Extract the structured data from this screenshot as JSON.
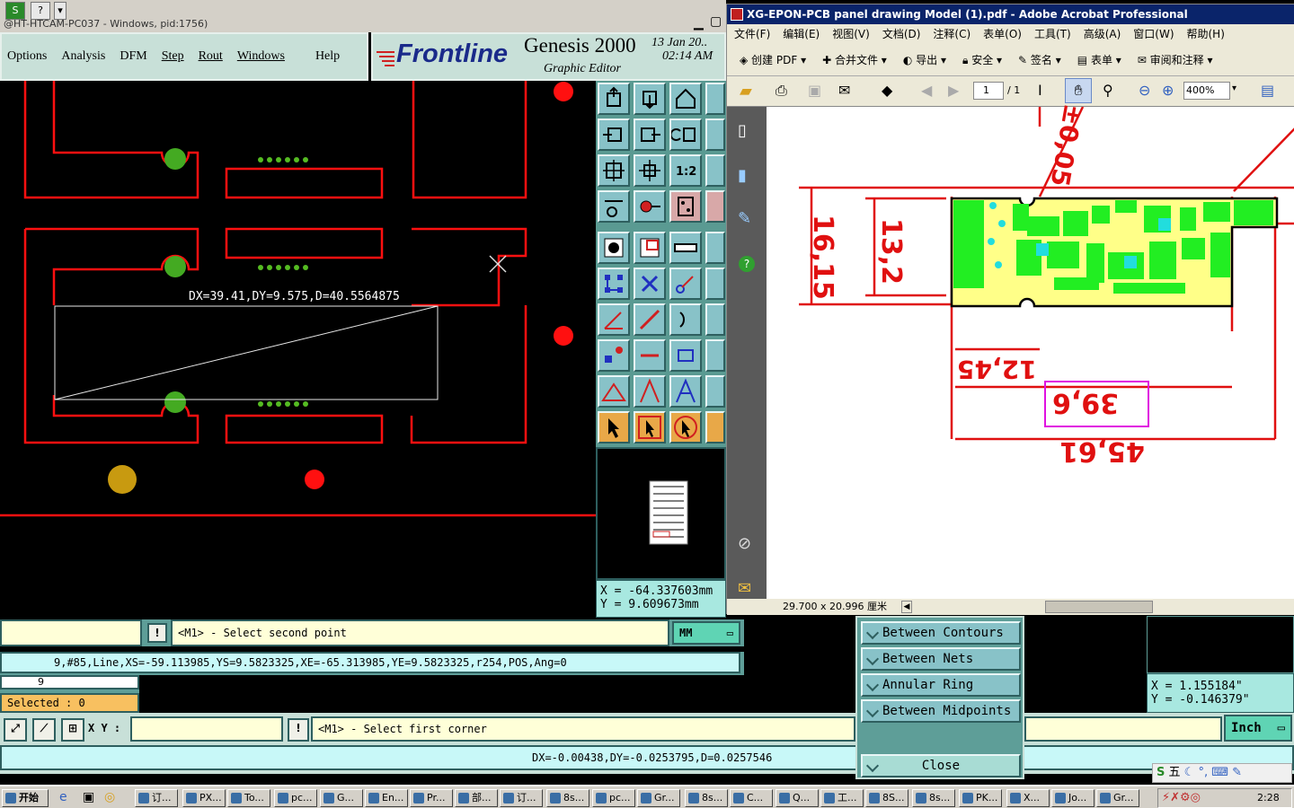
{
  "genesis": {
    "window_title": "@HT-HTCAM-PC037 - Windows, pid:1756)",
    "menu": [
      "Options",
      "Analysis",
      "DFM",
      "Step",
      "Rout",
      "Windows",
      "Help"
    ],
    "logo_text": "Frontline",
    "product": "Genesis 2000",
    "subtitle": "Graphic Editor",
    "date": "13 Jan 20..",
    "time": "02:14 AM",
    "measure_label": "DX=39.41,DY=9.575,D=40.5564875",
    "coords": {
      "x": "X = -64.337603mm",
      "y": "Y = 9.609673mm"
    },
    "prompt1": "<M1> - Select second point",
    "units1": "MM",
    "feature_info": "9,#85,Line,XS=-59.113985,YS=9.5823325,XE=-65.313985,YE=9.5823325,r254,POS,Ang=0",
    "layer_num": "9",
    "selected": "Selected : 0",
    "xy_label": "X Y :",
    "prompt2": "<M1> - Select first corner",
    "delta": "DX=-0.00438,DY=-0.0253795,D=0.0257546",
    "coords2": {
      "x": "X = 1.155184\"",
      "y": "Y = -0.146379\""
    },
    "units2": "Inch",
    "info_button": "!"
  },
  "dfm_menu": {
    "items": [
      "Between Contours",
      "Between Nets",
      "Annular Ring",
      "Between Midpoints"
    ],
    "close": "Close"
  },
  "acrobat": {
    "title": "XG-EPON-PCB panel drawing Model (1).pdf - Adobe Acrobat Professional",
    "menu": [
      "文件(F)",
      "编辑(E)",
      "视图(V)",
      "文档(D)",
      "注释(C)",
      "表单(O)",
      "工具(T)",
      "高级(A)",
      "窗口(W)",
      "帮助(H)"
    ],
    "toolbar": [
      "创建 PDF",
      "合并文件",
      "导出",
      "安全",
      "签名",
      "表单",
      "审阅和注释"
    ],
    "page_num": "1",
    "page_total": "/ 1",
    "zoom": "400%",
    "page_size": "29.700 x 20.996 厘米",
    "dims": {
      "d1": "16,15",
      "d2": "13,2",
      "d3": "12,45",
      "d4": "39,6",
      "d5": "45,61",
      "d6": "±0,05"
    }
  },
  "taskbar": {
    "start": "开始",
    "tasks": [
      "订...",
      "PX...",
      "To...",
      "pc...",
      "G...",
      "En...",
      "Pr...",
      "部...",
      "订...",
      "8s...",
      "pc...",
      "Gr...",
      "8s...",
      "C...",
      "Q...",
      "工...",
      "8S...",
      "8s...",
      "PK...",
      "X...",
      "Jo...",
      "Gr..."
    ],
    "clock": "2:28",
    "ime": "五"
  },
  "colors": {
    "pcb_red": "#ff0000",
    "pad_green": "#44aa22",
    "teal": "#5e9e98",
    "panel_light": "#c8e0d8"
  }
}
